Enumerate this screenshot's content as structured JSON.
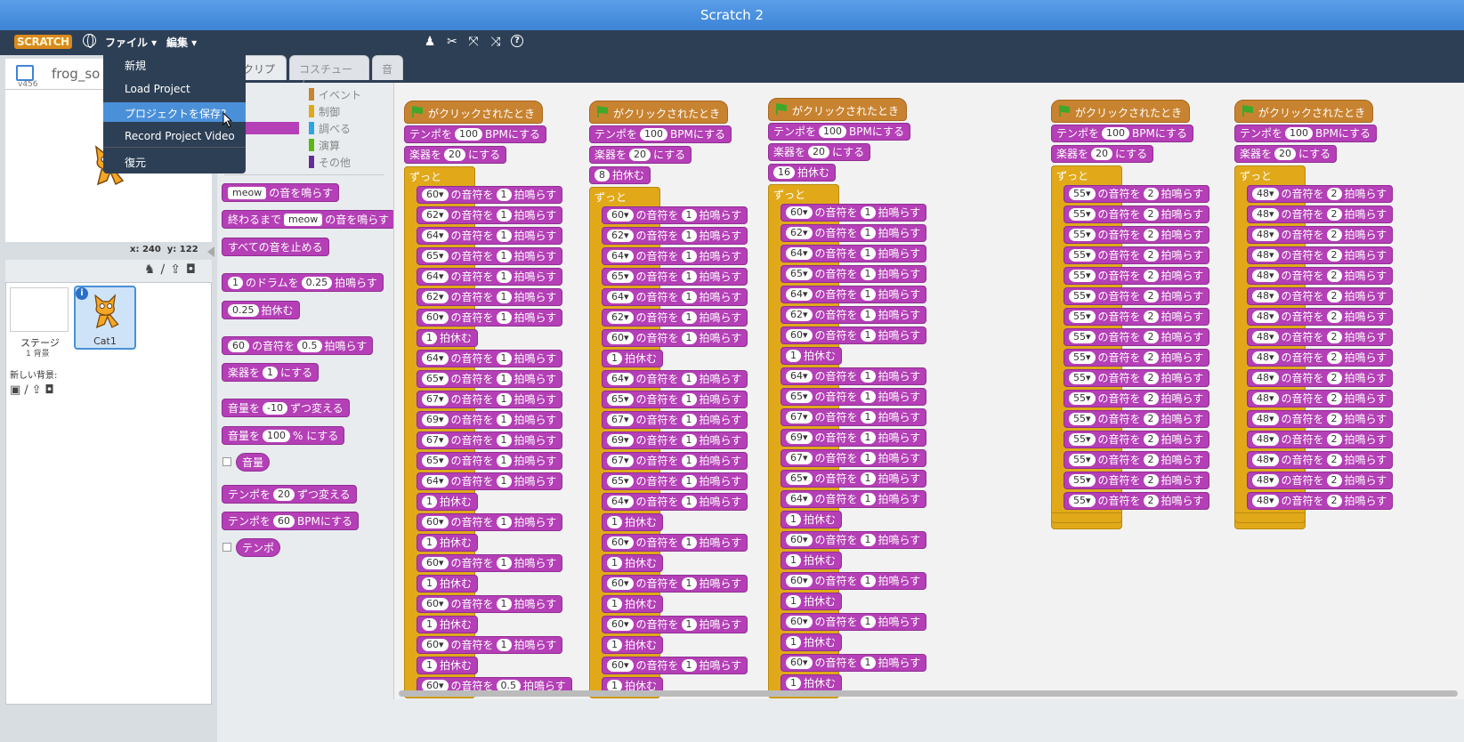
{
  "window": {
    "title": "Scratch 2"
  },
  "menubar": {
    "logo": "SCRATCH",
    "file": "ファイル ▾",
    "edit": "編集 ▾"
  },
  "file_menu": {
    "items": [
      "新規",
      "Load Project",
      "プロジェクトを保存?",
      "Record Project Video",
      "復元"
    ],
    "highlighted_index": 2
  },
  "stage": {
    "project_title": "frog_so",
    "version": "v456",
    "x_label": "x:",
    "x_value": "240",
    "y_label": "y:",
    "y_value": "122"
  },
  "sprites": {
    "stage_label": "ステージ",
    "stage_sub": "1 背景",
    "new_backdrop": "新しい背景:",
    "cat_label": "Cat1"
  },
  "tabs": [
    "スクリプト",
    "コスチューム",
    "音"
  ],
  "categories": [
    {
      "label": "イベント",
      "color": "#c88330"
    },
    {
      "label": "制御",
      "color": "#e1a91a"
    },
    {
      "label": "調べる",
      "color": "#2ca5e2"
    },
    {
      "label": "演算",
      "color": "#5cb712"
    },
    {
      "label": "その他",
      "color": "#632d99"
    }
  ],
  "palette": {
    "meow_prefix": "meow",
    "meow_suffix": "の音を鳴らす",
    "until_prefix": "終わるまで",
    "until_mid": "meow",
    "until_suffix": "の音を鳴らす",
    "stop_all": "すべての音を止める",
    "drum_num": "1",
    "drum_mid": "のドラムを",
    "drum_beats": "0.25",
    "drum_suffix": "拍鳴らす",
    "rest_beats": "0.25",
    "rest_suffix": "拍休む",
    "note_num": "60",
    "note_mid": "の音符を",
    "note_beats": "0.5",
    "note_suffix": "拍鳴らす",
    "inst_prefix": "楽器を",
    "inst_num": "1",
    "inst_suffix": "にする",
    "vol_change_prefix": "音量を",
    "vol_change_val": "-10",
    "vol_change_suffix": "ずつ変える",
    "vol_set_prefix": "音量を",
    "vol_set_val": "100",
    "vol_set_suffix": "% にする",
    "vol_reporter": "音量",
    "tempo_change_prefix": "テンポを",
    "tempo_change_val": "20",
    "tempo_change_suffix": "ずつ変える",
    "tempo_set_prefix": "テンポを",
    "tempo_set_val": "60",
    "tempo_set_suffix": "BPMにする",
    "tempo_reporter": "テンポ"
  },
  "scripts": {
    "hat_label": "がクリックされたとき",
    "tempo_prefix": "テンポを",
    "tempo_val": "100",
    "tempo_suffix": "BPMにする",
    "inst_prefix": "楽器を",
    "inst_val": "20",
    "inst_suffix": "にする",
    "forever": "ずっと",
    "note_mid": "の音符を",
    "note_suffix": "拍鳴らす",
    "rest_suffix": "拍休む",
    "col1": [
      "60",
      "62",
      "64",
      "65",
      "64",
      "62",
      "60",
      "R1",
      "64",
      "65",
      "67",
      "69",
      "67",
      "65",
      "64",
      "R1",
      "60",
      "R1",
      "60",
      "R1",
      "60",
      "R1",
      "60",
      "R1",
      "60"
    ],
    "col1_beats": [
      "1",
      "1",
      "1",
      "1",
      "1",
      "1",
      "1",
      "1",
      "1",
      "1",
      "1",
      "1",
      "1",
      "1",
      "1",
      "1",
      "1",
      "1",
      "1",
      "1",
      "1",
      "1",
      "1",
      "1",
      "0.5"
    ],
    "col2_pre": "8",
    "col2": [
      "60",
      "62",
      "64",
      "65",
      "64",
      "62",
      "60",
      "R1",
      "64",
      "65",
      "67",
      "69",
      "67",
      "65",
      "64",
      "R1",
      "60",
      "R1",
      "60",
      "R1",
      "60",
      "R1",
      "60",
      "R1"
    ],
    "col3_pre": "16",
    "col3": [
      "60",
      "62",
      "64",
      "65",
      "64",
      "62",
      "60",
      "R1",
      "64",
      "65",
      "67",
      "69",
      "67",
      "65",
      "64",
      "R1",
      "60",
      "R1",
      "60",
      "R1",
      "60",
      "R1",
      "60",
      "R1"
    ],
    "col4_note": "55",
    "col5_note": "48",
    "loop_beats": "2"
  }
}
